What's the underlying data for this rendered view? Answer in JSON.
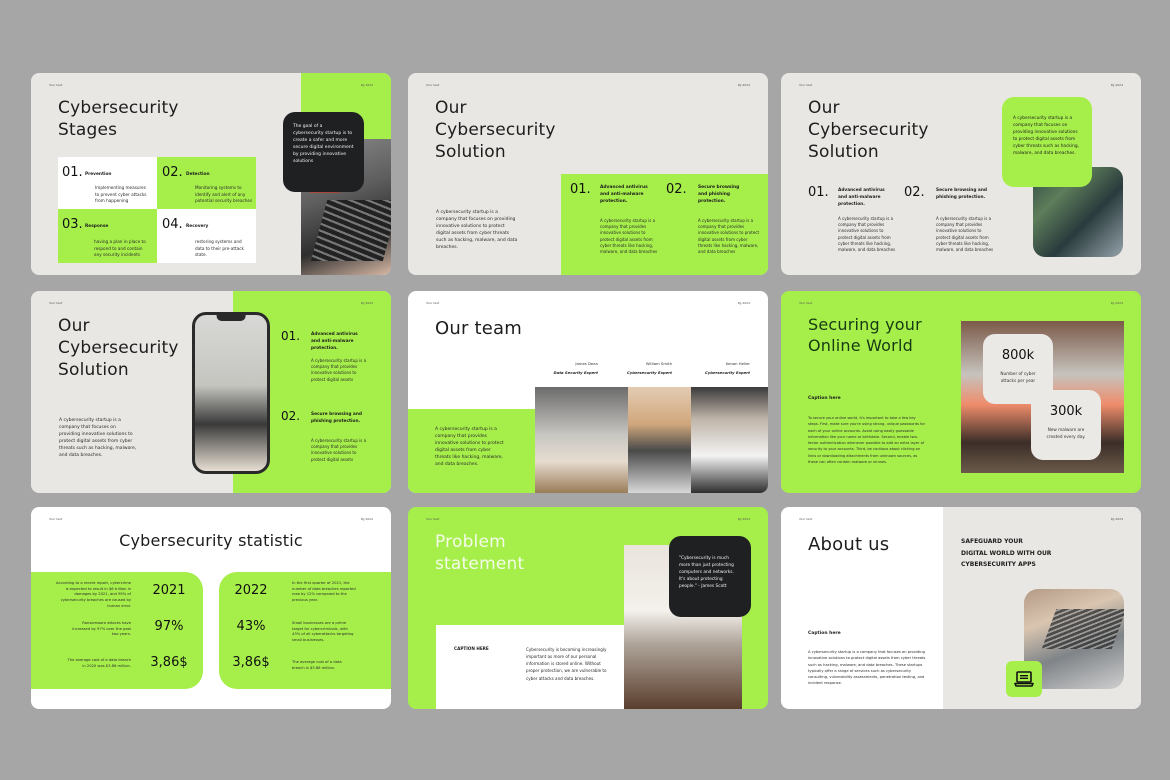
{
  "header": {
    "left": "Your text",
    "right": "Pg 2024"
  },
  "colors": {
    "accent": "#a6ef4b",
    "dark": "#1f2022",
    "light_bg": "#e9e7e4",
    "page_bg": "#a6a6a6"
  },
  "slides": [
    {
      "title_l1": "Cybersecurity",
      "title_l2": "Stages",
      "quote": "The goal of a cybersecurity startup is to create a safer and more secure digital environment by providing innovative solutions",
      "stages": [
        {
          "num": "01.",
          "label": "Prevention",
          "text": "Implementing measures to prevent cyber attacks from happening"
        },
        {
          "num": "02.",
          "label": "Detection",
          "text": "Monitoring systems to identify and alert of any potential security breaches"
        },
        {
          "num": "03.",
          "label": "Response",
          "text": "having a plan in place to respond to and contain any security incidents"
        },
        {
          "num": "04.",
          "label": "Recovery",
          "text": "restoring systems and data to their pre-attack state."
        }
      ],
      "photo": "keyboard-photo"
    },
    {
      "title_l1": "Our",
      "title_l2": "Cybersecurity",
      "title_l3": "Solution",
      "body": "A cybersecurity startup is a company that focuses on providing innovative solutions to protect digital assets from cyber threats such as hacking, malware, and data breaches.",
      "items": [
        {
          "num": "01.",
          "heading": "Advanced antivirus and anti-malware protection.",
          "text": "A cybersecurity startup is a company that provides innovative solutions to protect digital assets from cyber threats like hacking, malware, and data breaches"
        },
        {
          "num": "02.",
          "heading": "Secure browsing and phishing protection.",
          "text": "A cybersecurity startup is a company that provides innovative solutions to protect digital assets from cyber threats like hacking, malware, and data breaches"
        }
      ]
    },
    {
      "title_l1": "Our",
      "title_l2": "Cybersecurity",
      "title_l3": "Solution",
      "callout": "A cybersecurity startup is a company that focuses on providing innovative solutions to protect digital assets from cyber threats such as hacking, malware, and data breaches.",
      "items": [
        {
          "num": "01.",
          "heading": "Advanced antivirus and anti-malware protection.",
          "text": "A cybersecurity startup is a company that provides innovative solutions to protect digital assets from cyber threats like hacking, malware, and data breaches"
        },
        {
          "num": "02.",
          "heading": "Secure browsing and phishing protection.",
          "text": "A cybersecurity startup is a company that provides innovative solutions to protect digital assets from cyber threats like hacking, malware, and data breaches"
        }
      ]
    },
    {
      "title_l1": "Our",
      "title_l2": "Cybersecurity",
      "title_l3": "Solution",
      "body": "A cybersecurity startup is a company that focuses on providing innovative solutions to protect digital assets from cyber threats such as hacking, malware, and data breaches.",
      "items": [
        {
          "num": "01.",
          "heading": "Advanced antivirus and anti-malware protection.",
          "text": "A cybersecurity startup is a company that provides innovative solutions to protect digital assets"
        },
        {
          "num": "02.",
          "heading": "Secure browsing and phishing protection.",
          "text": "A cybersecurity startup is a company that provides innovative solutions to protect digital assets"
        }
      ]
    },
    {
      "title": "Our team",
      "body": "A cybersecurity startup is a company that provides innovative solutions to protect digital assets from cyber threats like hacking, malware, and data breaches.",
      "members": [
        {
          "name": "James Dean",
          "role": "Data Security Expert"
        },
        {
          "name": "William Smith",
          "role": "Cybersecurity Expert"
        },
        {
          "name": "Kenan Heller",
          "role": "Cybersecurity Expert"
        }
      ]
    },
    {
      "title_l1": "Securing your",
      "title_l2": "Online World",
      "caption": "Caption here",
      "body": "To secure your online world, it's important to take a few key steps. First, make sure you're using strong, unique passwords for each of your online accounts. Avoid using easily guessable information like your name or birthdate. Second, enable two-factor authentication whenever possible to add an extra layer of security to your accounts. Third, be cautious about clicking on links or downloading attachments from unknown sources, as these can often contain malware or viruses.",
      "stats": [
        {
          "value": "800k",
          "label": "Number of cyber attacks per year"
        },
        {
          "value": "300k",
          "label": "New malware are created every day."
        }
      ]
    },
    {
      "title": "Cybersecurity statistic",
      "left": [
        {
          "text": "According to a recent report, cybercrime is expected to result in $6 trillion in damages by 2021, and 95% of cybersecurity breaches are caused by human error.",
          "value": "2021"
        },
        {
          "text": "Ransomware attacks have increased by 97% over the past two years.",
          "value": "97%"
        },
        {
          "text": "The average cost of a data breach in 2020 was $3.86 million.",
          "value": "3,86$"
        }
      ],
      "right": [
        {
          "value": "2022",
          "text": "In the first quarter of 2021, the number of data breaches reported rose by 12% compared to the previous year."
        },
        {
          "value": "43%",
          "text": "Small businesses are a prime target for cybercriminals, with 43% of all cyberattacks targeting small businesses."
        },
        {
          "value": "3,86$",
          "text": "The average cost of a data breach is $3.86 million."
        }
      ]
    },
    {
      "title_l1": "Problem",
      "title_l2": "statement",
      "caption": "CAPTION HERE",
      "body": "Cybersecurity is becoming increasingly important as more of our personal information is stored online. Without proper protection, we are vulnerable to cyber attacks and data breaches.",
      "quote": "\"Cybersecurity is much more than just protecting computers and networks. It's about protecting people.\" - James Scott"
    },
    {
      "title": "About us",
      "tagline_l1": "SAFEGUARD YOUR",
      "tagline_l2": "DIGITAL WORLD WITH OUR",
      "tagline_l3": "CYBERSECURITY APPS",
      "caption": "Caption here",
      "body": "A cybersecurity startup is a company that focuses on providing innovative solutions to protect digital assets from cyber threats such as hacking, malware, and data breaches. These startups typically offer a range of services such as cybersecurity consulting, vulnerability assessments, penetration testing, and incident response.",
      "icon": "laptop-icon"
    }
  ]
}
